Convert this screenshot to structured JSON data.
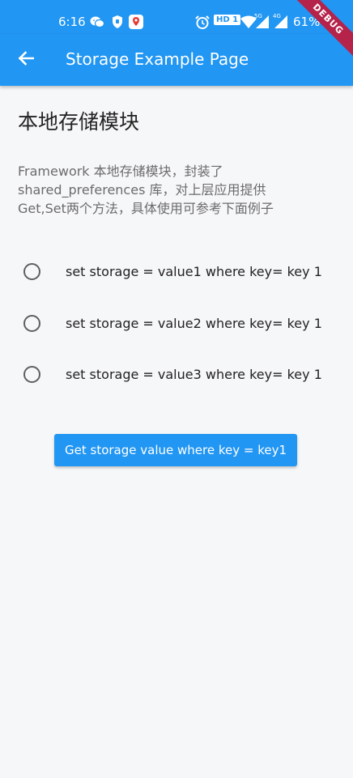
{
  "status_bar": {
    "time": "6:16",
    "hd_badge": "HD 1",
    "network_5g": "5G",
    "network_4g": "4G",
    "battery": "61%",
    "icons": [
      "wechat-icon",
      "shield-icon",
      "location-app-icon",
      "alarm-icon",
      "wifi-icon",
      "signal-icon",
      "battery-icon"
    ]
  },
  "debug_banner": "DEBUG",
  "app_bar": {
    "back_icon": "arrow-back-icon",
    "title": "Storage Example Page"
  },
  "content": {
    "heading": "本地存储模块",
    "description_lines": [
      "Framework 本地存储模块，封装了",
      "shared_preferences 库，对上层应用提供",
      "Get,Set两个方法，具体使用可参考下面例子"
    ],
    "options": [
      {
        "label": "set storage = value1 where key= key 1",
        "selected": false
      },
      {
        "label": "set storage = value2 where key= key 1",
        "selected": false
      },
      {
        "label": "set storage = value3 where key= key 1",
        "selected": false
      }
    ],
    "get_button_label": "Get storage value where key = key1"
  },
  "colors": {
    "primary": "#2196f3",
    "background": "#f6f7f9",
    "debug_ribbon": "#b5224a"
  }
}
